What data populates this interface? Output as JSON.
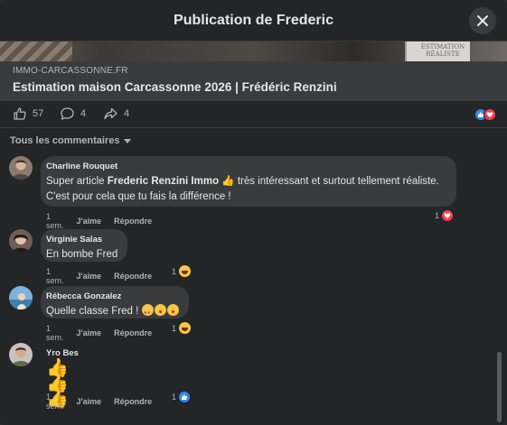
{
  "dialog": {
    "title": "Publication de Frederic",
    "close_icon": "close-icon"
  },
  "link_preview": {
    "image_caption": "ESTIMATION RÉALISTE",
    "domain": "IMMO-CARCASSONNE.FR",
    "title": "Estimation maison Carcassonne 2026 | Frédéric Renzini"
  },
  "post_actions": {
    "likes": "57",
    "comments": "4",
    "shares": "4"
  },
  "filter": {
    "label": "Tous les commentaires"
  },
  "comments": [
    {
      "author": "Charline Rouquet",
      "text_before": "Super article ",
      "text_bold": "Frederic Renzini Immo",
      "text_after": " 👍 très intéressant et surtout tellement réaliste.",
      "text_line2": "C'est pour cela que tu fais la différence !",
      "time": "1 sem.",
      "like": "J'aime",
      "reply": "Répondre",
      "reactions": "1"
    },
    {
      "author": "Virginie Salas",
      "text": "En bombe Fred",
      "time": "1 sem.",
      "like": "J'aime",
      "reply": "Répondre",
      "reactions": "1"
    },
    {
      "author": "Rébecca Gonzalez",
      "text": "Quelle classe Fred !",
      "time": "1 sem.",
      "like": "J'aime",
      "reply": "Répondre",
      "reactions": "1"
    },
    {
      "author": "Yro Bes",
      "text": "👍👍👍",
      "time": "1 sem.",
      "like": "J'aime",
      "reply": "Répondre",
      "reactions": "1"
    }
  ],
  "colors": {
    "background": "#242526",
    "bubble": "#3a3b3c",
    "like_blue": "#2d88ff",
    "love_red": "#f33e58",
    "text": "#e4e6eb",
    "muted": "#b0b3b8"
  }
}
